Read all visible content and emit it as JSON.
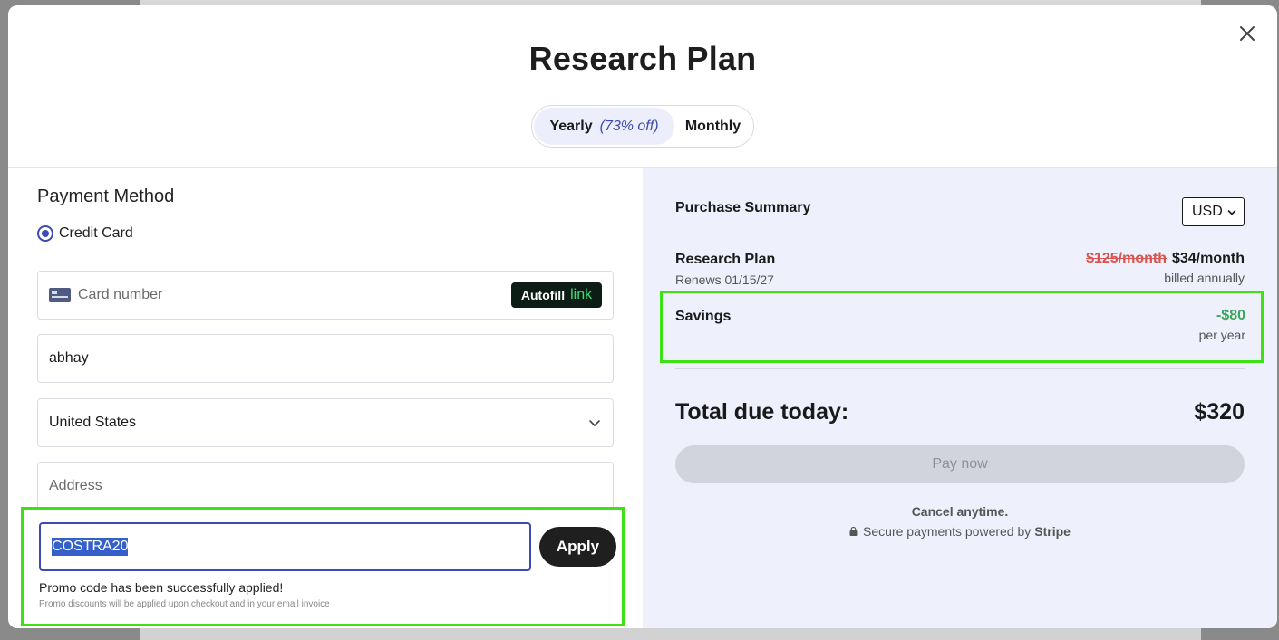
{
  "modal": {
    "title": "Research Plan"
  },
  "billing_toggle": {
    "yearly_label": "Yearly",
    "yearly_discount": "(73% off)",
    "monthly_label": "Monthly",
    "selected": "Yearly"
  },
  "payment": {
    "title": "Payment Method",
    "method_label": "Credit Card",
    "card_number_placeholder": "Card number",
    "autofill_label": "Autofill",
    "autofill_link": "link",
    "name_value": "abhay",
    "country_value": "United States",
    "address_placeholder": "Address",
    "promo_code_value": "COSTRA20",
    "apply_label": "Apply",
    "promo_success": "Promo code has been successfully applied!",
    "promo_note": "Promo discounts will be applied upon checkout and in your email invoice"
  },
  "summary": {
    "title": "Purchase Summary",
    "currency": "USD",
    "plan_name": "Research Plan",
    "renews": "Renews 01/15/27",
    "price_old": "$125/month",
    "price_new": "$34/month",
    "billed": "billed annually",
    "savings_label": "Savings",
    "savings_value": "-$80",
    "savings_period": "per year",
    "total_label": "Total due today:",
    "total_value": "$320",
    "pay_label": "Pay now",
    "cancel_text": "Cancel anytime.",
    "secure_text": "Secure payments powered by",
    "secure_brand": "Stripe"
  },
  "colors": {
    "accent": "#3b4bb0",
    "highlight_border": "#3ee016",
    "savings_green": "#3aa65a",
    "strike_red": "#d9534f",
    "summary_bg": "#eef0fb"
  }
}
